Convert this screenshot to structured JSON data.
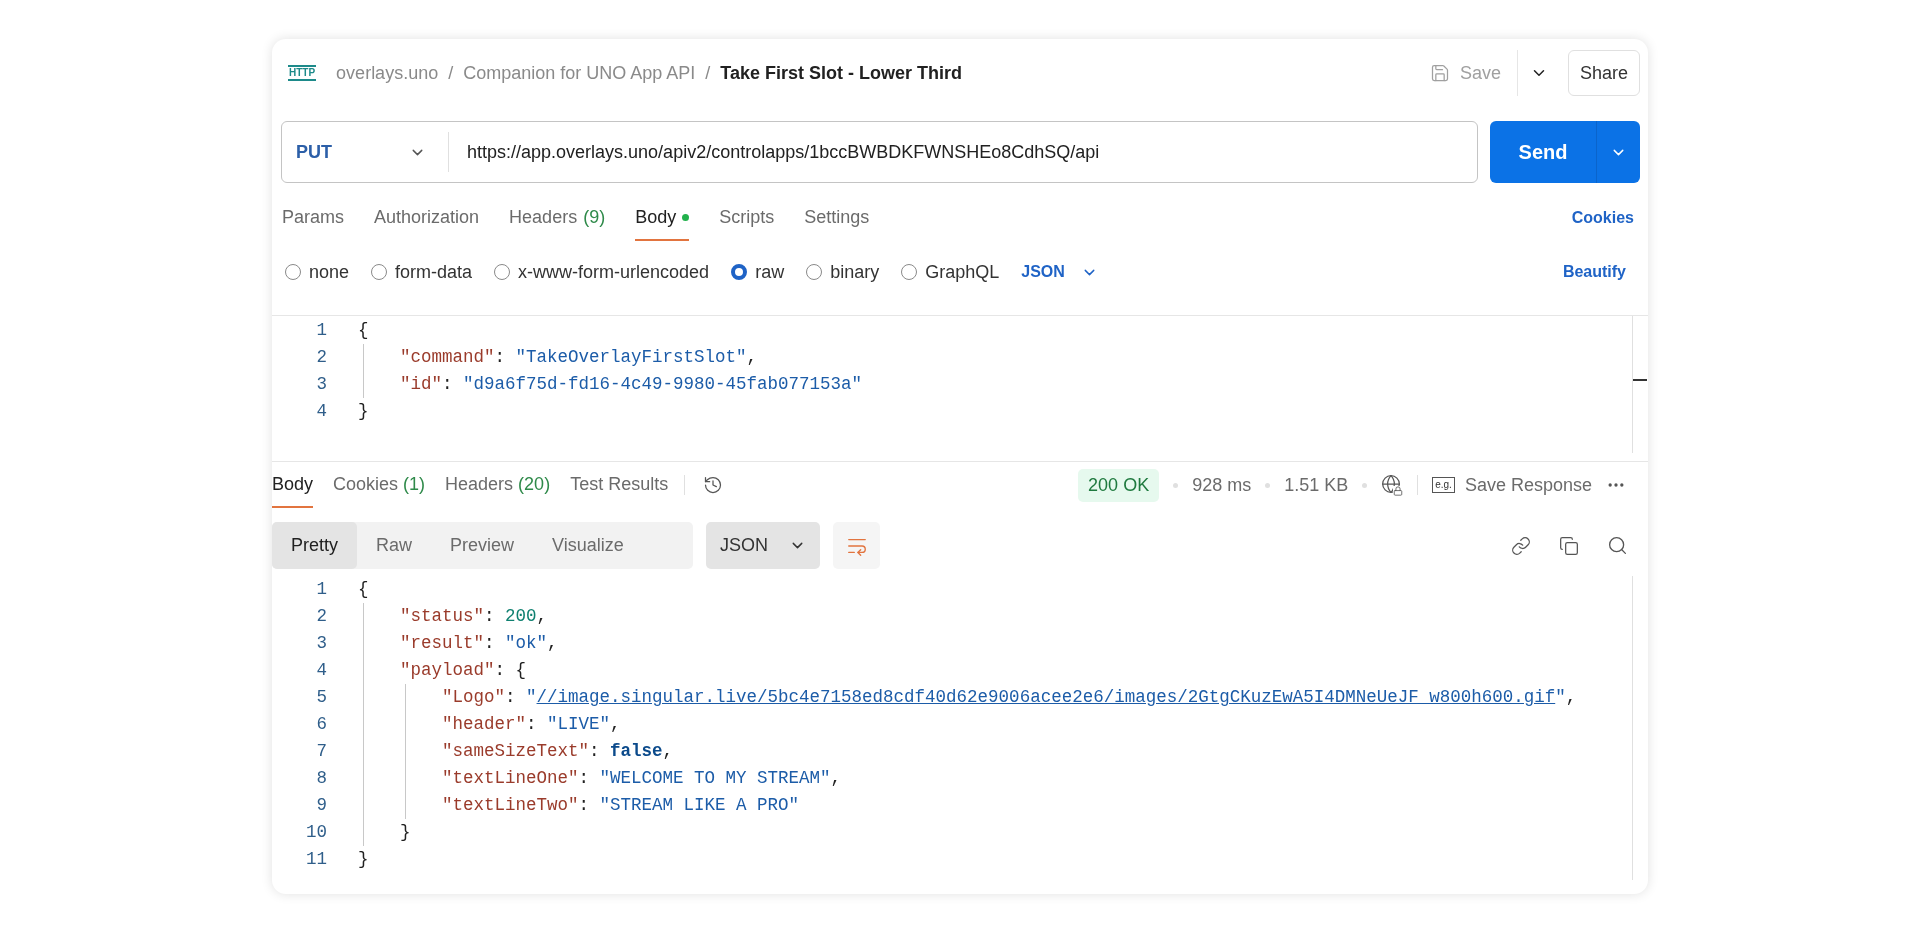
{
  "header": {
    "request_icon_label": "HTTP",
    "breadcrumb": [
      "overlays.uno",
      "Companion for UNO App API"
    ],
    "separator": "/",
    "title": "Take First Slot - Lower Third",
    "save_label": "Save",
    "share_label": "Share"
  },
  "request": {
    "method": "PUT",
    "url": "https://app.overlays.uno/apiv2/controlapps/1bccBWBDKFWNSHEo8CdhSQ/api",
    "send_label": "Send"
  },
  "request_tabs": [
    {
      "label": "Params",
      "selected": false,
      "has_content": false
    },
    {
      "label": "Authorization",
      "selected": false,
      "has_content": false
    },
    {
      "label": "Headers",
      "count": "(9)",
      "selected": false,
      "has_content": false
    },
    {
      "label": "Body",
      "selected": true,
      "has_content": true
    },
    {
      "label": "Scripts",
      "selected": false,
      "has_content": false
    },
    {
      "label": "Settings",
      "selected": false,
      "has_content": false
    }
  ],
  "cookies_link": "Cookies",
  "body_types": [
    {
      "label": "none",
      "selected": false
    },
    {
      "label": "form-data",
      "selected": false
    },
    {
      "label": "x-www-form-urlencoded",
      "selected": false
    },
    {
      "label": "raw",
      "selected": true
    },
    {
      "label": "binary",
      "selected": false
    },
    {
      "label": "GraphQL",
      "selected": false
    }
  ],
  "body_format": "JSON",
  "beautify_label": "Beautify",
  "request_body": [
    {
      "n": "1",
      "tokens": [
        {
          "kind": "punct",
          "text": "{"
        }
      ],
      "children": [
        {
          "n": "2",
          "tokens": [
            {
              "kind": "key",
              "text": "\"command\""
            },
            {
              "kind": "punct",
              "text": ": "
            },
            {
              "kind": "string",
              "text": "\"TakeOverlayFirstSlot\""
            },
            {
              "kind": "punct",
              "text": ","
            }
          ]
        },
        {
          "n": "3",
          "tokens": [
            {
              "kind": "key",
              "text": "\"id\""
            },
            {
              "kind": "punct",
              "text": ": "
            },
            {
              "kind": "string",
              "text": "\"d9a6f75d-fd16-4c49-9980-45fab077153a\""
            }
          ]
        }
      ]
    },
    {
      "n": "4",
      "tokens": [
        {
          "kind": "punct",
          "text": "}"
        }
      ]
    }
  ],
  "response_tabs": [
    {
      "label": "Body",
      "selected": true
    },
    {
      "label": "Cookies",
      "count": "(1)",
      "selected": false
    },
    {
      "label": "Headers",
      "count": "(20)",
      "selected": false
    },
    {
      "label": "Test Results",
      "selected": false
    }
  ],
  "status": {
    "code": "200 OK",
    "time": "928 ms",
    "size": "1.51 KB",
    "example_icon_label": "e.g.",
    "save_response_label": "Save Response"
  },
  "view_modes": [
    {
      "label": "Pretty",
      "selected": true
    },
    {
      "label": "Raw",
      "selected": false
    },
    {
      "label": "Preview",
      "selected": false
    },
    {
      "label": "Visualize",
      "selected": false
    }
  ],
  "response_format": "JSON",
  "line_wrap_on": true,
  "response_body": [
    {
      "n": "1",
      "tokens": [
        {
          "kind": "punct",
          "text": "{"
        }
      ],
      "children": [
        {
          "n": "2",
          "tokens": [
            {
              "kind": "key",
              "text": "\"status\""
            },
            {
              "kind": "punct",
              "text": ": "
            },
            {
              "kind": "number",
              "text": "200"
            },
            {
              "kind": "punct",
              "text": ","
            }
          ]
        },
        {
          "n": "3",
          "tokens": [
            {
              "kind": "key",
              "text": "\"result\""
            },
            {
              "kind": "punct",
              "text": ": "
            },
            {
              "kind": "string",
              "text": "\"ok\""
            },
            {
              "kind": "punct",
              "text": ","
            }
          ]
        },
        {
          "n": "4",
          "tokens": [
            {
              "kind": "key",
              "text": "\"payload\""
            },
            {
              "kind": "punct",
              "text": ": {"
            }
          ],
          "children": [
            {
              "n": "5",
              "tokens": [
                {
                  "kind": "key",
                  "text": "\"Logo\""
                },
                {
                  "kind": "punct",
                  "text": ": "
                },
                {
                  "kind": "string",
                  "text": "\""
                },
                {
                  "kind": "link",
                  "text": "//image.singular.live/5bc4e7158ed8cdf40d62e9006acee2e6/images/2GtgCKuzEwA5I4DMNeUeJF_w800h600.gif"
                },
                {
                  "kind": "string",
                  "text": "\""
                },
                {
                  "kind": "punct",
                  "text": ","
                }
              ]
            },
            {
              "n": "6",
              "tokens": [
                {
                  "kind": "key",
                  "text": "\"header\""
                },
                {
                  "kind": "punct",
                  "text": ": "
                },
                {
                  "kind": "string",
                  "text": "\"LIVE\""
                },
                {
                  "kind": "punct",
                  "text": ","
                }
              ]
            },
            {
              "n": "7",
              "tokens": [
                {
                  "kind": "key",
                  "text": "\"sameSizeText\""
                },
                {
                  "kind": "punct",
                  "text": ": "
                },
                {
                  "kind": "boolean",
                  "text": "false"
                },
                {
                  "kind": "punct",
                  "text": ","
                }
              ]
            },
            {
              "n": "8",
              "tokens": [
                {
                  "kind": "key",
                  "text": "\"textLineOne\""
                },
                {
                  "kind": "punct",
                  "text": ": "
                },
                {
                  "kind": "string",
                  "text": "\"WELCOME TO MY STREAM\""
                },
                {
                  "kind": "punct",
                  "text": ","
                }
              ]
            },
            {
              "n": "9",
              "tokens": [
                {
                  "kind": "key",
                  "text": "\"textLineTwo\""
                },
                {
                  "kind": "punct",
                  "text": ": "
                },
                {
                  "kind": "string",
                  "text": "\"STREAM LIKE A PRO\""
                }
              ]
            }
          ]
        },
        {
          "n": "10",
          "tokens": [
            {
              "kind": "punct",
              "text": "}"
            }
          ]
        }
      ]
    },
    {
      "n": "11",
      "tokens": [
        {
          "kind": "punct",
          "text": "}"
        }
      ]
    }
  ]
}
